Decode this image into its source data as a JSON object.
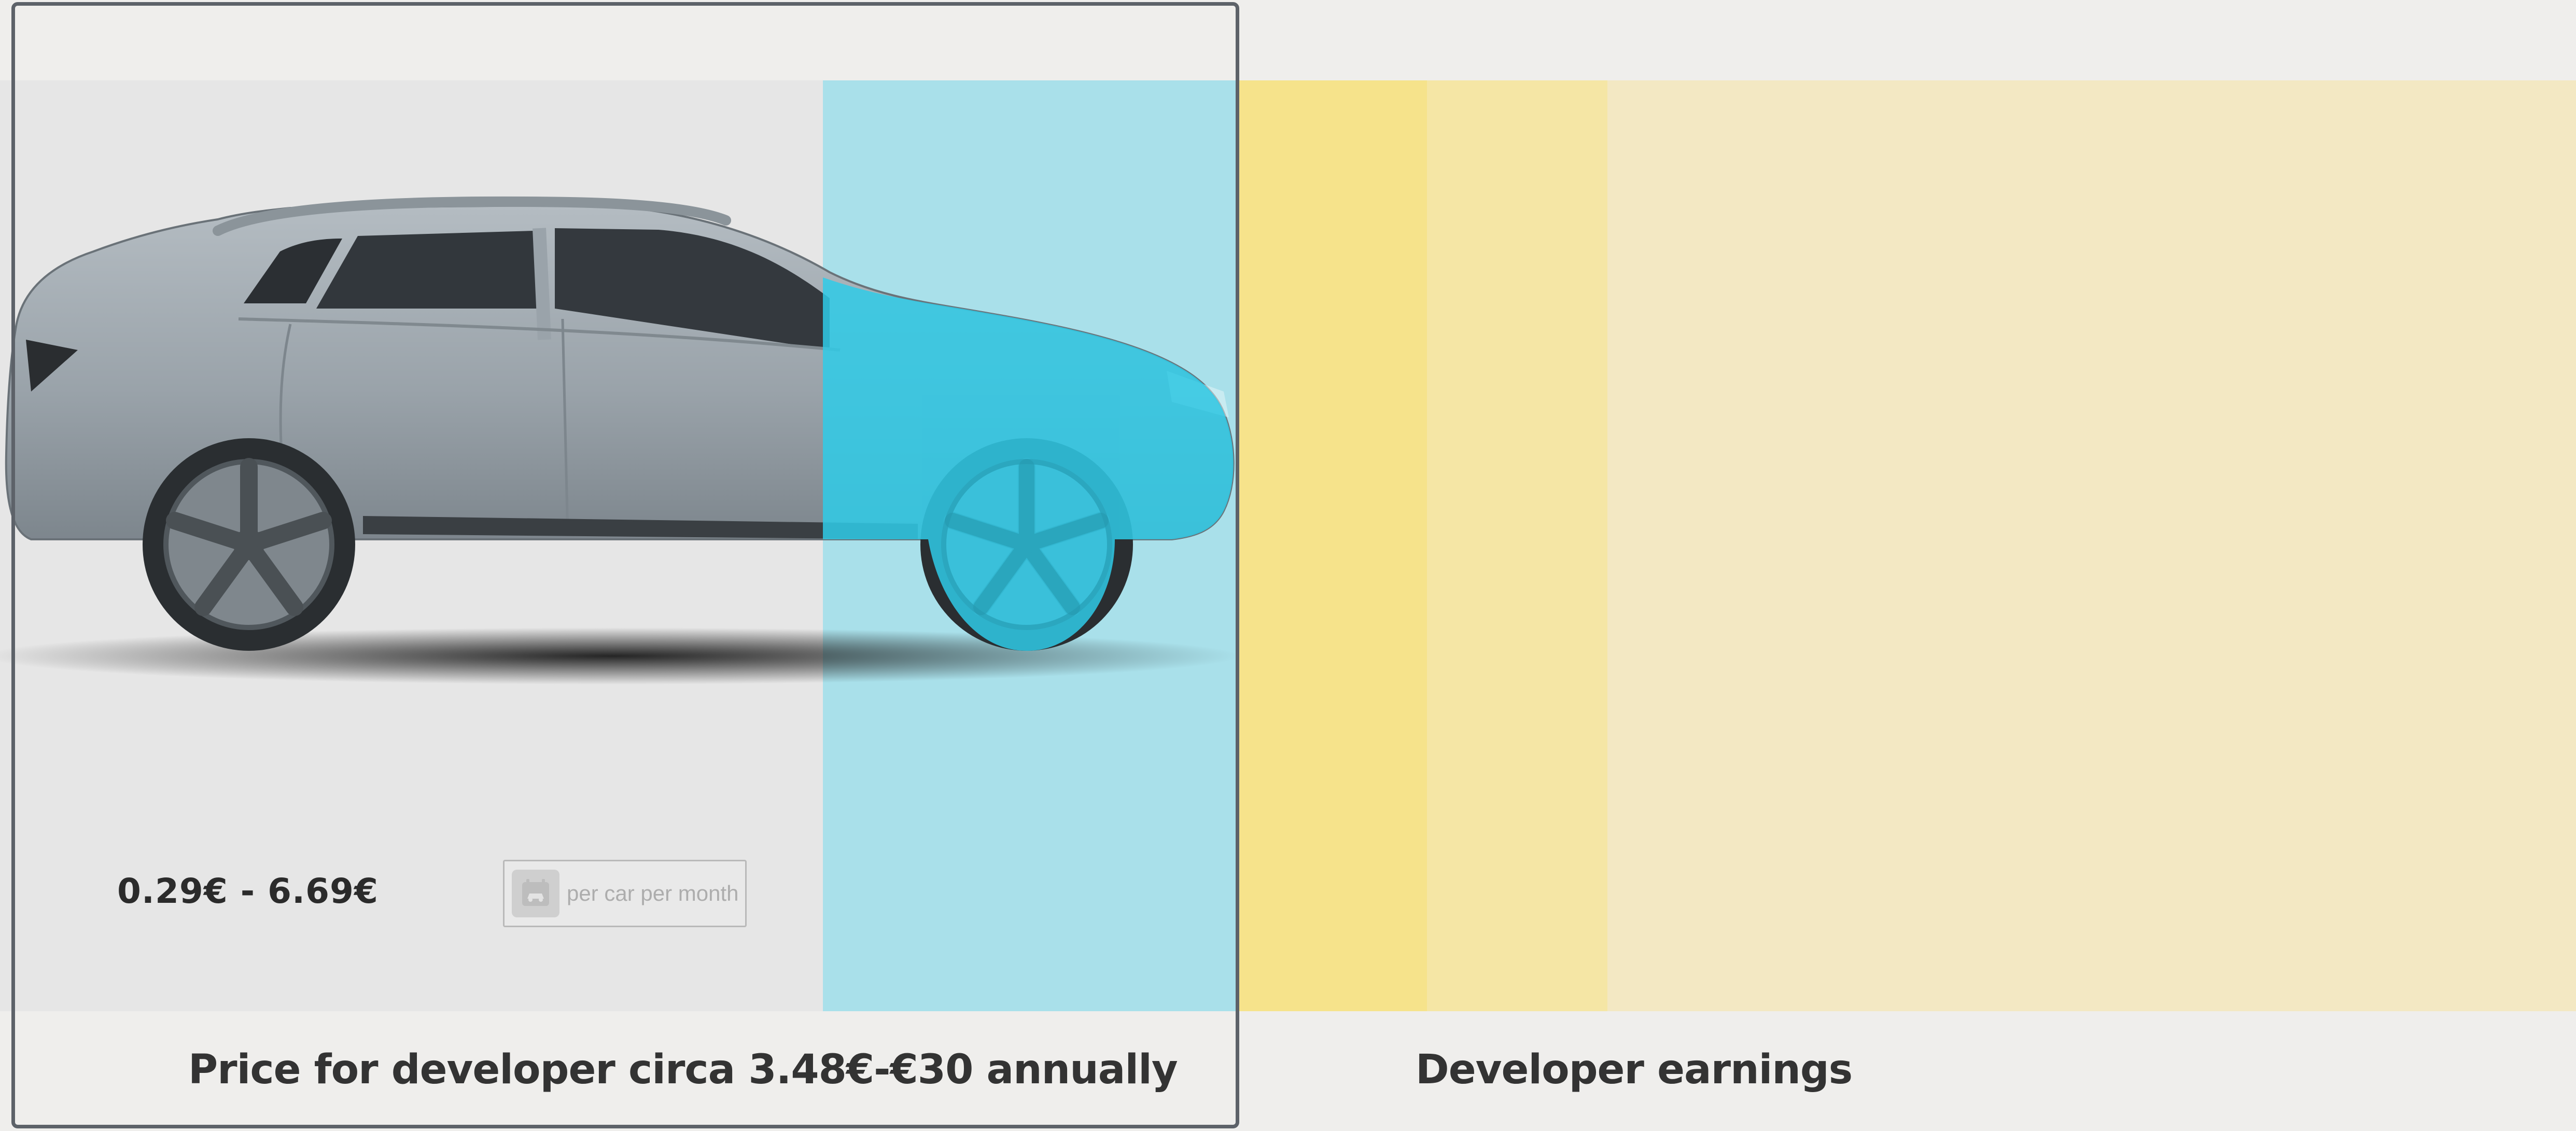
{
  "product": {
    "price_range": "0.29€ - 6.69€",
    "billing_unit": "per car per month",
    "billing_icon": "car-calendar-icon"
  },
  "captions": {
    "left": "Price for developer circa 3.48€-€30 annually",
    "right": "Developer earnings"
  },
  "colors": {
    "background": "#efeeec",
    "stage": "#e6e6e6",
    "cyan_band": "#a9e0ea",
    "cyan_car": "#2fcbe8",
    "yellow_1": "#f6e38b",
    "yellow_2": "#f5e6a5",
    "yellow_3": "#f3e8c3",
    "frame": "#5d6269"
  }
}
